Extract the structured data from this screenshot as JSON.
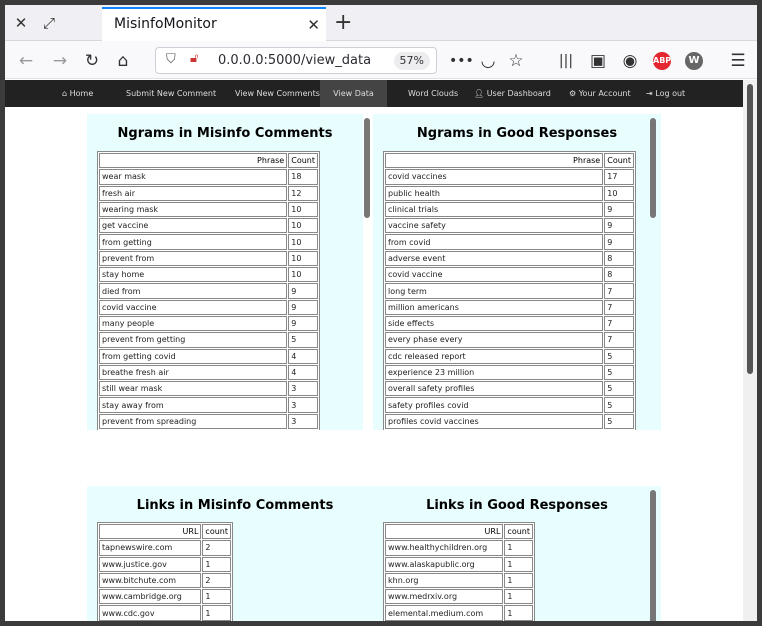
{
  "browser": {
    "tab_title": "MisinfoMonitor",
    "url": "0.0.0.0:5000/view_data",
    "zoom": "57%"
  },
  "nav": {
    "home": "Home",
    "submit": "Submit New Comment",
    "view_new": "View New Comments",
    "view_data": "View Data",
    "word_clouds": "Word Clouds",
    "user_dashboard": "User Dashboard",
    "your_account": "Your Account",
    "log_out": "Log out"
  },
  "ngrams_misinfo": {
    "title": "Ngrams in Misinfo Comments",
    "col_phrase": "Phrase",
    "col_count": "Count",
    "rows": [
      [
        "wear mask",
        "18"
      ],
      [
        "fresh air",
        "12"
      ],
      [
        "wearing mask",
        "10"
      ],
      [
        "get vaccine",
        "10"
      ],
      [
        "from getting",
        "10"
      ],
      [
        "prevent from",
        "10"
      ],
      [
        "stay home",
        "10"
      ],
      [
        "died from",
        "9"
      ],
      [
        "covid vaccine",
        "9"
      ],
      [
        "many people",
        "9"
      ],
      [
        "prevent from getting",
        "5"
      ],
      [
        "from getting covid",
        "4"
      ],
      [
        "breathe fresh air",
        "4"
      ],
      [
        "still wear mask",
        "3"
      ],
      [
        "stay away from",
        "3"
      ],
      [
        "prevent from spreading",
        "3"
      ]
    ]
  },
  "ngrams_good": {
    "title": "Ngrams in Good Responses",
    "col_phrase": "Phrase",
    "col_count": "Count",
    "rows": [
      [
        "covid vaccines",
        "17"
      ],
      [
        "public health",
        "10"
      ],
      [
        "clinical trials",
        "9"
      ],
      [
        "vaccine safety",
        "9"
      ],
      [
        "from covid",
        "9"
      ],
      [
        "adverse event",
        "8"
      ],
      [
        "covid vaccine",
        "8"
      ],
      [
        "long term",
        "7"
      ],
      [
        "million americans",
        "7"
      ],
      [
        "side effects",
        "7"
      ],
      [
        "every phase every",
        "7"
      ],
      [
        "cdc released report",
        "5"
      ],
      [
        "experience 23 million",
        "5"
      ],
      [
        "overall safety profiles",
        "5"
      ],
      [
        "safety profiles covid",
        "5"
      ],
      [
        "profiles covid vaccines",
        "5"
      ]
    ]
  },
  "links_misinfo": {
    "title": "Links in Misinfo Comments",
    "col_url": "URL",
    "col_count": "count",
    "rows": [
      [
        "tapnewswire.com",
        "2"
      ],
      [
        "www.justice.gov",
        "1"
      ],
      [
        "www.bitchute.com",
        "2"
      ],
      [
        "www.cambridge.org",
        "1"
      ],
      [
        "www.cdc.gov",
        "1"
      ]
    ]
  },
  "links_good": {
    "title": "Links in Good Responses",
    "col_url": "URL",
    "col_count": "count",
    "rows": [
      [
        "www.healthychildren.org",
        "1"
      ],
      [
        "www.alaskapublic.org",
        "1"
      ],
      [
        "khn.org",
        "1"
      ],
      [
        "www.medrxiv.org",
        "1"
      ],
      [
        "elemental.medium.com",
        "1"
      ]
    ]
  }
}
